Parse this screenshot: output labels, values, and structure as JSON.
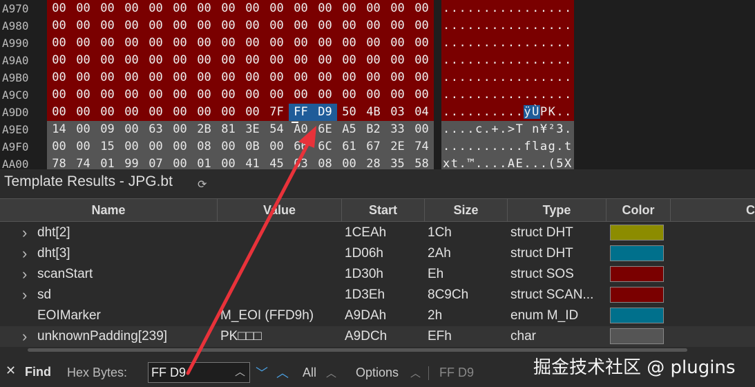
{
  "hex_view": {
    "rows": [
      {
        "addr": "A970",
        "bytes": [
          "00",
          "00",
          "00",
          "00",
          "00",
          "00",
          "00",
          "00",
          "00",
          "00",
          "00",
          "00",
          "00",
          "00",
          "00",
          "00"
        ],
        "ascii": "................",
        "style": "red"
      },
      {
        "addr": "A980",
        "bytes": [
          "00",
          "00",
          "00",
          "00",
          "00",
          "00",
          "00",
          "00",
          "00",
          "00",
          "00",
          "00",
          "00",
          "00",
          "00",
          "00"
        ],
        "ascii": "................",
        "style": "red"
      },
      {
        "addr": "A990",
        "bytes": [
          "00",
          "00",
          "00",
          "00",
          "00",
          "00",
          "00",
          "00",
          "00",
          "00",
          "00",
          "00",
          "00",
          "00",
          "00",
          "00"
        ],
        "ascii": "................",
        "style": "red"
      },
      {
        "addr": "A9A0",
        "bytes": [
          "00",
          "00",
          "00",
          "00",
          "00",
          "00",
          "00",
          "00",
          "00",
          "00",
          "00",
          "00",
          "00",
          "00",
          "00",
          "00"
        ],
        "ascii": "................",
        "style": "red"
      },
      {
        "addr": "A9B0",
        "bytes": [
          "00",
          "00",
          "00",
          "00",
          "00",
          "00",
          "00",
          "00",
          "00",
          "00",
          "00",
          "00",
          "00",
          "00",
          "00",
          "00"
        ],
        "ascii": "................",
        "style": "red"
      },
      {
        "addr": "A9C0",
        "bytes": [
          "00",
          "00",
          "00",
          "00",
          "00",
          "00",
          "00",
          "00",
          "00",
          "00",
          "00",
          "00",
          "00",
          "00",
          "00",
          "00"
        ],
        "ascii": "................",
        "style": "red"
      },
      {
        "addr": "A9D0",
        "bytes": [
          "00",
          "00",
          "00",
          "00",
          "00",
          "00",
          "00",
          "00",
          "00",
          "00",
          "7F",
          "FF",
          "D9",
          "50",
          "4B",
          "03",
          "04"
        ],
        "ascii": "..........ÿÙPK..",
        "style": "mixed"
      },
      {
        "addr": "A9E0",
        "bytes": [
          "14",
          "00",
          "09",
          "00",
          "63",
          "00",
          "2B",
          "81",
          "3E",
          "54",
          "A0",
          "6E",
          "A5",
          "B2",
          "33",
          "00"
        ],
        "ascii": "....c.+.>T n¥²3.",
        "style": "grey"
      },
      {
        "addr": "A9F0",
        "bytes": [
          "00",
          "00",
          "15",
          "00",
          "00",
          "00",
          "08",
          "00",
          "0B",
          "00",
          "66",
          "6C",
          "61",
          "67",
          "2E",
          "74"
        ],
        "ascii": "..........flag.t",
        "style": "grey"
      },
      {
        "addr": "AA00",
        "bytes": [
          "78",
          "74",
          "01",
          "99",
          "07",
          "00",
          "01",
          "00",
          "41",
          "45",
          "03",
          "08",
          "00",
          "28",
          "35",
          "58"
        ],
        "ascii": "xt.™....AE...(5X",
        "style": "grey"
      }
    ]
  },
  "template_results": {
    "title": "Template Results - JPG.bt",
    "columns": [
      "Name",
      "Value",
      "Start",
      "Size",
      "Type",
      "Color",
      "C"
    ],
    "rows": [
      {
        "name": "dht[2]",
        "value": "",
        "start": "1CEAh",
        "size": "1Ch",
        "type": "struct DHT",
        "color": "#8c8c00",
        "expandable": true
      },
      {
        "name": "dht[3]",
        "value": "",
        "start": "1D06h",
        "size": "2Ah",
        "type": "struct DHT",
        "color": "#00708c",
        "expandable": true
      },
      {
        "name": "scanStart",
        "value": "",
        "start": "1D30h",
        "size": "Eh",
        "type": "struct SOS",
        "color": "#7a0000",
        "expandable": true
      },
      {
        "name": "sd",
        "value": "",
        "start": "1D3Eh",
        "size": "8C9Ch",
        "type": "struct SCAN...",
        "color": "#7a0000",
        "expandable": true
      },
      {
        "name": "EOIMarker",
        "value": "M_EOI (FFD9h)",
        "start": "A9DAh",
        "size": "2h",
        "type": "enum M_ID",
        "color": "#00708c",
        "expandable": false
      },
      {
        "name": "unknownPadding[239]",
        "value": "PK□□□",
        "start": "A9DCh",
        "size": "EFh",
        "type": "char",
        "color": "#555555",
        "expandable": true
      }
    ]
  },
  "find_bar": {
    "label": "Find",
    "hex_label": "Hex Bytes:",
    "input_value": "FF D9",
    "all_label": "All",
    "options_label": "Options",
    "history_value": "FF D9"
  },
  "watermark": "掘金技术社区 @ plugins"
}
